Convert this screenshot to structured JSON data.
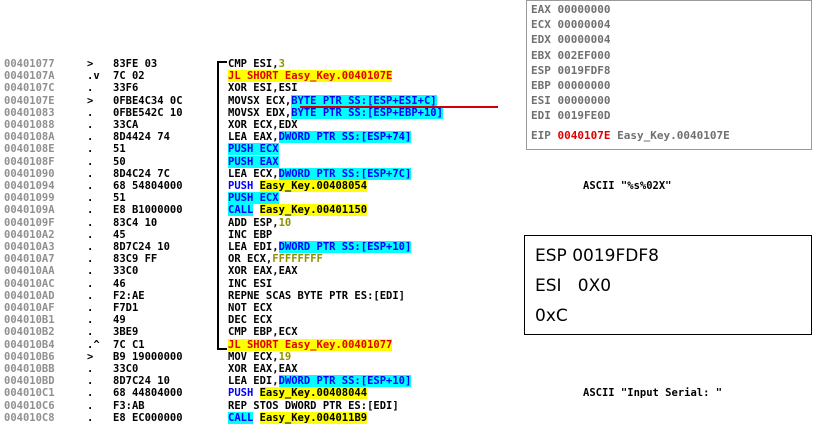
{
  "rows": [
    {
      "addr": "00401077",
      "mark": ">",
      "hex": "83FE 03",
      "asm": [
        {
          "t": "CMP ESI,"
        },
        {
          "t": "3",
          "c": "olive"
        }
      ],
      "cmt": ""
    },
    {
      "addr": "0040107A",
      "mark": ".v",
      "hex": "7C 02",
      "asm": [
        {
          "t": "JL SHORT Easy_Key.0040107E",
          "c": "y red"
        }
      ],
      "cmt": ""
    },
    {
      "addr": "0040107C",
      "mark": ".",
      "hex": "33F6",
      "asm": [
        {
          "t": "XOR ESI,ESI"
        }
      ],
      "cmt": ""
    },
    {
      "addr": "0040107E",
      "mark": ">",
      "hex": "0FBE4C34 0C",
      "asm": [
        {
          "t": "MOVSX ECX,"
        },
        {
          "t": "BYTE PTR SS:[ESP+ESI+C]",
          "c": "c blue"
        }
      ],
      "cmt": ""
    },
    {
      "addr": "00401083",
      "mark": ".",
      "hex": "0FBE542C 10",
      "asm": [
        {
          "t": "MOVSX EDX,"
        },
        {
          "t": "BYTE PTR SS:[ESP+EBP+10]",
          "c": "c blue"
        }
      ],
      "cmt": ""
    },
    {
      "addr": "00401088",
      "mark": ".",
      "hex": "33CA",
      "asm": [
        {
          "t": "XOR ECX,EDX"
        }
      ],
      "cmt": ""
    },
    {
      "addr": "0040108A",
      "mark": ".",
      "hex": "8D4424 74",
      "asm": [
        {
          "t": "LEA EAX,"
        },
        {
          "t": "DWORD PTR SS:[ESP+74]",
          "c": "c blue"
        }
      ],
      "cmt": ""
    },
    {
      "addr": "0040108E",
      "mark": ".",
      "hex": "51",
      "asm": [
        {
          "t": "PUSH ECX",
          "c": "c blue"
        }
      ],
      "cmt": ""
    },
    {
      "addr": "0040108F",
      "mark": ".",
      "hex": "50",
      "asm": [
        {
          "t": "PUSH EAX",
          "c": "c blue"
        }
      ],
      "cmt": ""
    },
    {
      "addr": "00401090",
      "mark": ".",
      "hex": "8D4C24 7C",
      "asm": [
        {
          "t": "LEA ECX,"
        },
        {
          "t": "DWORD PTR SS:[ESP+7C]",
          "c": "c blue"
        }
      ],
      "cmt": ""
    },
    {
      "addr": "00401094",
      "mark": ".",
      "hex": "68 54804000",
      "asm": [
        {
          "t": "PUSH ",
          "c": "blue"
        },
        {
          "t": "Easy_Key.00408054",
          "c": "y"
        }
      ],
      "cmt": "ASCII \"%s%02X\""
    },
    {
      "addr": "00401099",
      "mark": ".",
      "hex": "51",
      "asm": [
        {
          "t": "PUSH ECX",
          "c": "c blue"
        }
      ],
      "cmt": ""
    },
    {
      "addr": "0040109A",
      "mark": ".",
      "hex": "E8 B1000000",
      "asm": [
        {
          "t": "CALL",
          "c": "c blue"
        },
        {
          "t": " "
        },
        {
          "t": "Easy_Key.00401150",
          "c": "y"
        }
      ],
      "cmt": ""
    },
    {
      "addr": "0040109F",
      "mark": ".",
      "hex": "83C4 10",
      "asm": [
        {
          "t": "ADD ESP,"
        },
        {
          "t": "10",
          "c": "olive"
        }
      ],
      "cmt": ""
    },
    {
      "addr": "004010A2",
      "mark": ".",
      "hex": "45",
      "asm": [
        {
          "t": "INC EBP"
        }
      ],
      "cmt": ""
    },
    {
      "addr": "004010A3",
      "mark": ".",
      "hex": "8D7C24 10",
      "asm": [
        {
          "t": "LEA EDI,"
        },
        {
          "t": "DWORD PTR SS:[ESP+10]",
          "c": "c blue"
        }
      ],
      "cmt": ""
    },
    {
      "addr": "004010A7",
      "mark": ".",
      "hex": "83C9 FF",
      "asm": [
        {
          "t": "OR ECX,"
        },
        {
          "t": "FFFFFFFF",
          "c": "olive"
        }
      ],
      "cmt": ""
    },
    {
      "addr": "004010AA",
      "mark": ".",
      "hex": "33C0",
      "asm": [
        {
          "t": "XOR EAX,EAX"
        }
      ],
      "cmt": ""
    },
    {
      "addr": "004010AC",
      "mark": ".",
      "hex": "46",
      "asm": [
        {
          "t": "INC ESI"
        }
      ],
      "cmt": ""
    },
    {
      "addr": "004010AD",
      "mark": ".",
      "hex": "F2:AE",
      "asm": [
        {
          "t": "REPNE SCAS BYTE PTR ES:[EDI]"
        }
      ],
      "cmt": ""
    },
    {
      "addr": "004010AF",
      "mark": ".",
      "hex": "F7D1",
      "asm": [
        {
          "t": "NOT ECX"
        }
      ],
      "cmt": ""
    },
    {
      "addr": "004010B1",
      "mark": ".",
      "hex": "49",
      "asm": [
        {
          "t": "DEC ECX"
        }
      ],
      "cmt": ""
    },
    {
      "addr": "004010B2",
      "mark": ".",
      "hex": "3BE9",
      "asm": [
        {
          "t": "CMP EBP,ECX"
        }
      ],
      "cmt": ""
    },
    {
      "addr": "004010B4",
      "mark": ".^",
      "hex": "7C C1",
      "asm": [
        {
          "t": "JL SHORT Easy_Key.00401077",
          "c": "y red"
        }
      ],
      "cmt": ""
    },
    {
      "addr": "004010B6",
      "mark": ">",
      "hex": "B9 19000000",
      "asm": [
        {
          "t": "MOV ECX,"
        },
        {
          "t": "19",
          "c": "olive"
        }
      ],
      "cmt": ""
    },
    {
      "addr": "004010BB",
      "mark": ".",
      "hex": "33C0",
      "asm": [
        {
          "t": "XOR EAX,EAX"
        }
      ],
      "cmt": ""
    },
    {
      "addr": "004010BD",
      "mark": ".",
      "hex": "8D7C24 10",
      "asm": [
        {
          "t": "LEA EDI,"
        },
        {
          "t": "DWORD PTR SS:[ESP+10]",
          "c": "c blue"
        }
      ],
      "cmt": ""
    },
    {
      "addr": "004010C1",
      "mark": ".",
      "hex": "68 44804000",
      "asm": [
        {
          "t": "PUSH ",
          "c": "blue"
        },
        {
          "t": "Easy_Key.00408044",
          "c": "y"
        }
      ],
      "cmt": "ASCII \"Input Serial: \""
    },
    {
      "addr": "004010C6",
      "mark": ".",
      "hex": "F3:AB",
      "asm": [
        {
          "t": "REP STOS DWORD PTR ES:[EDI]"
        }
      ],
      "cmt": ""
    },
    {
      "addr": "004010C8",
      "mark": ".",
      "hex": "E8 EC000000",
      "asm": [
        {
          "t": "CALL",
          "c": "c blue"
        },
        {
          "t": " "
        },
        {
          "t": "Easy_Key.004011B9",
          "c": "y"
        }
      ],
      "cmt": ""
    }
  ],
  "registers": [
    {
      "name": "EAX",
      "value": "00000000"
    },
    {
      "name": "ECX",
      "value": "00000004"
    },
    {
      "name": "EDX",
      "value": "00000004"
    },
    {
      "name": "EBX",
      "value": "002EF000"
    },
    {
      "name": "ESP",
      "value": "0019FDF8"
    },
    {
      "name": "EBP",
      "value": "00000000"
    },
    {
      "name": "ESI",
      "value": "00000000"
    },
    {
      "name": "EDI",
      "value": "0019FE0D"
    }
  ],
  "eip": {
    "name": "EIP",
    "value": "0040107E",
    "label": "Easy_Key.0040107E"
  },
  "note": {
    "line1": "ESP 0019FDF8",
    "line2": "ESI   0X0",
    "line3": "0xC"
  }
}
